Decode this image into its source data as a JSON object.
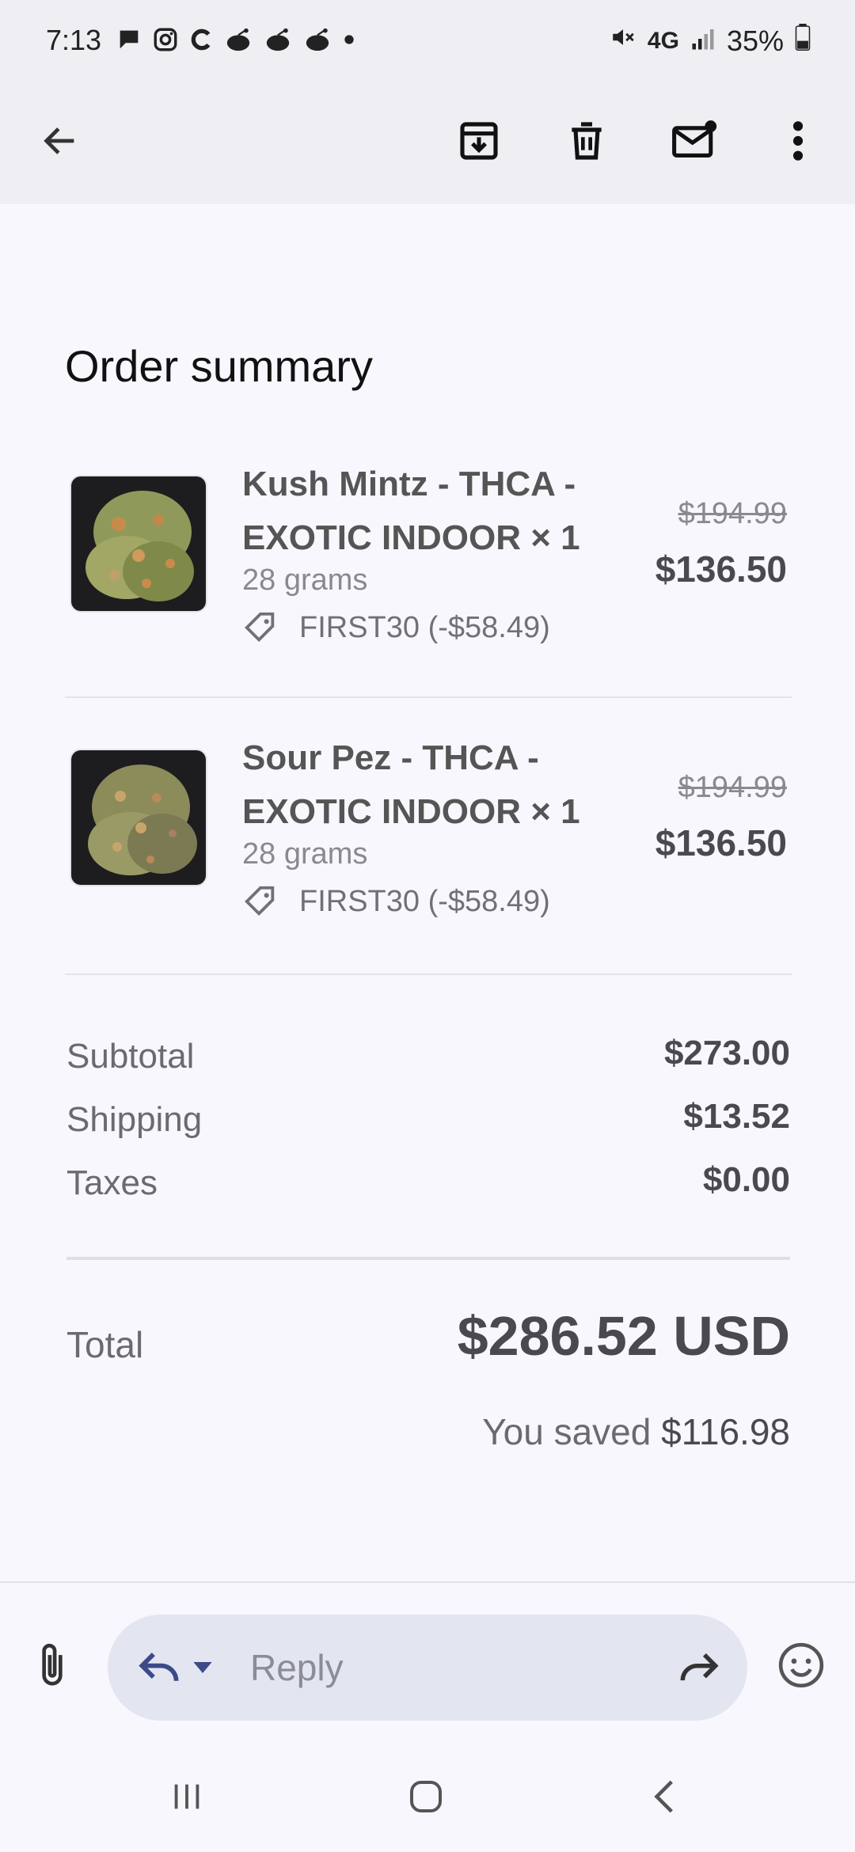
{
  "status_bar": {
    "time": "7:13",
    "network": "4G",
    "battery": "35%"
  },
  "app_bar": {
    "actions": [
      "back-arrow-icon",
      "archive-icon",
      "delete-icon",
      "mark-unread-icon",
      "more-vert-icon"
    ]
  },
  "order": {
    "title": "Order summary",
    "items": [
      {
        "name": "Kush Mintz - THCA - EXOTIC INDOOR × 1",
        "variant": "28 grams",
        "discount": "FIRST30 (-$58.49)",
        "original_price": "$194.99",
        "price": "$136.50"
      },
      {
        "name": "Sour Pez - THCA - EXOTIC INDOOR × 1",
        "variant": "28 grams",
        "discount": "FIRST30 (-$58.49)",
        "original_price": "$194.99",
        "price": "$136.50"
      }
    ],
    "summary": {
      "subtotal_label": "Subtotal",
      "subtotal": "$273.00",
      "shipping_label": "Shipping",
      "shipping": "$13.52",
      "taxes_label": "Taxes",
      "taxes": "$0.00"
    },
    "total_label": "Total",
    "total": "$286.52 USD",
    "saved_label": "You saved",
    "saved_amount": "$116.98"
  },
  "reply_bar": {
    "placeholder": "Reply"
  },
  "colors": {
    "accent": "#3c4a8a",
    "header_bg": "#efeff3",
    "page_bg": "#f8f7fd",
    "reply_pill": "#e3e5f1"
  }
}
